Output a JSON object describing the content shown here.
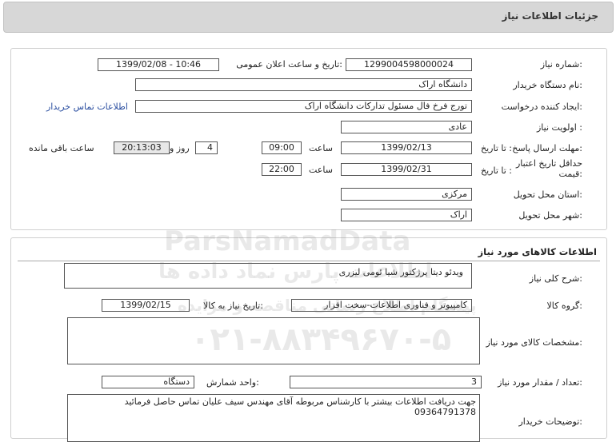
{
  "header": {
    "title": "جزئیات اطلاعات نیاز"
  },
  "info": {
    "need_number_label": "شماره نیاز:",
    "need_number": "1299004598000024",
    "announce_label": "تاریخ و ساعت اعلان عمومی:",
    "announce_value": "1399/02/08 - 10:46",
    "buyer_label": "نام دستگاه خریدار:",
    "buyer_value": "دانشگاه اراک",
    "creator_label": "ایجاد کننده درخواست:",
    "creator_value": "تورج فرخ فال مسئول تدارکات دانشگاه اراک",
    "contact_link": "اطلاعات تماس خریدار",
    "priority_label": "اولویت نیاز :",
    "priority_value": "عادی",
    "deadline_label": "مهلت ارسال پاسخ:",
    "to_date_label": "تا تاریخ :",
    "deadline_date": "1399/02/13",
    "time_label": "ساعت",
    "deadline_time": "09:00",
    "days_value": "4",
    "days_label": "روز و",
    "remaining_time": "20:13:03",
    "remaining_label": "ساعت باقی مانده",
    "validity_label_1": "حداقل تاریخ اعتبار",
    "validity_label_2": "قیمت:",
    "validity_date": "1399/02/31",
    "validity_time": "22:00",
    "province_label": "استان محل تحویل:",
    "province_value": "مرکزی",
    "city_label": "شهر محل تحویل:",
    "city_value": "اراک"
  },
  "goods": {
    "section_title": "اطلاعات کالاهای مورد نیاز",
    "desc_label": "شرح کلی نیاز:",
    "desc_value": "ویدئو دیتا پرژکتور شیا ئومی لیزری",
    "group_label": "گروه کالا:",
    "group_value": "کامپیوتر و فناوری اطلاعات-سخت افزار",
    "need_date_label": "تاریخ نیاز به کالا:",
    "need_date": "1399/02/15",
    "specs_label": "مشخصات کالای مورد نیاز:",
    "qty_label": "تعداد / مقدار مورد نیاز:",
    "qty_value": "3",
    "unit_label": "واحد شمارش:",
    "unit_value": "دستگاه",
    "buyer_notes_label": "توضیحات خریدار:",
    "buyer_notes_line1": "جهت دریافت اطلاعات بیشتر با کارشناس مربوطه آقای مهندس سیف علیان تماس حاصل فرمائید",
    "buyer_notes_line2": "09364791378"
  },
  "watermark": {
    "brand": "ParsNamadData",
    "persian": "اطلاعات پارس نماد داده ها",
    "subtitle": "پیشگام اطلاع رسانی مناقصه و مزایده",
    "phone": "۰۲۱-۸۸۳۴۹۶۷۰-۵"
  }
}
